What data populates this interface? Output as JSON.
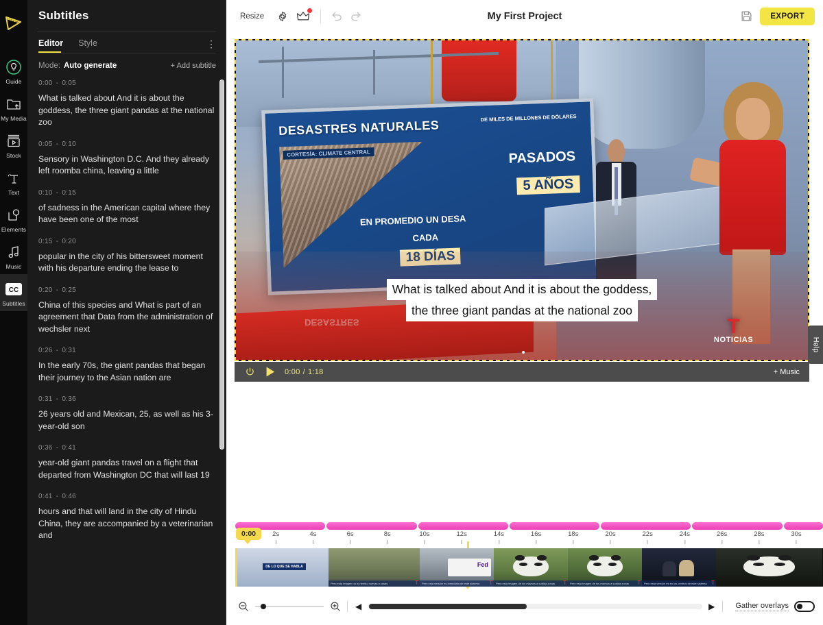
{
  "rail": {
    "logo_icon": "play-film-logo-icon",
    "items": [
      {
        "label": "Guide",
        "icon": "lightbulb-icon",
        "active": false
      },
      {
        "label": "My Media",
        "icon": "folder-upload-icon",
        "active": false
      },
      {
        "label": "Stock",
        "icon": "stock-video-icon",
        "active": false
      },
      {
        "label": "Text",
        "icon": "text-icon",
        "active": false
      },
      {
        "label": "Elements",
        "icon": "elements-shapes-icon",
        "active": false
      },
      {
        "label": "Music",
        "icon": "music-note-icon",
        "active": false
      },
      {
        "label": "Subtitles",
        "icon": "cc-icon",
        "active": true
      }
    ]
  },
  "panel": {
    "title": "Subtitles",
    "tabs": [
      {
        "label": "Editor",
        "active": true
      },
      {
        "label": "Style",
        "active": false
      }
    ],
    "kebab_icon": "more-vertical-icon",
    "mode_label": "Mode:",
    "mode_value": "Auto generate",
    "add_subtitle_label": "+ Add subtitle",
    "subtitles": [
      {
        "start": "0:00",
        "end": "0:05",
        "text": "What is talked about And it is about the goddess, the three giant pandas at the national zoo"
      },
      {
        "start": "0:05",
        "end": "0:10",
        "text": "Sensory in Washington D.C. And they already left roomba china, leaving a little"
      },
      {
        "start": "0:10",
        "end": "0:15",
        "text": "of sadness in the American capital where they have been one of the most"
      },
      {
        "start": "0:15",
        "end": "0:20",
        "text": "popular in the city of his bittersweet moment with his departure ending the lease to"
      },
      {
        "start": "0:20",
        "end": "0:25",
        "text": "China of this species and What is part of an agreement that Data from the administration of wechsler next"
      },
      {
        "start": "0:26",
        "end": "0:31",
        "text": "In the early 70s, the giant pandas that began their journey to the Asian nation are"
      },
      {
        "start": "0:31",
        "end": "0:36",
        "text": "26 years old and Mexican, 25, as well as his 3-year-old son"
      },
      {
        "start": "0:36",
        "end": "0:41",
        "text": "year-old giant pandas travel on a flight that departed from Washington DC that will last 19"
      },
      {
        "start": "0:41",
        "end": "0:46",
        "text": "hours and that will land in the city of Hindu China, they are accompanied by a veterinarian and"
      }
    ]
  },
  "toolbar": {
    "resize_label": "Resize",
    "settings_icon": "gear-icon",
    "upgrade_icon": "crown-icon",
    "undo_icon": "undo-icon",
    "redo_icon": "redo-icon",
    "project_title": "My First Project",
    "save_icon": "save-disk-icon",
    "export_label": "EXPORT"
  },
  "preview": {
    "caption_line1": "What is talked about And it is about the goddess,",
    "caption_line2": "the three giant pandas at the national zoo",
    "scene": {
      "board_title": "DESASTRES NATURALES",
      "board_subtitle": "DE MILES DE MILLONES DE DÓLARES",
      "board_courtesy": "CORTESÍA: CLIMATE CENTRAL",
      "board_pasados": "PASADOS",
      "board_years": "5 AÑOS",
      "board_promedio": "EN PROMEDIO UN DESA",
      "board_cada": "CADA",
      "board_dias": "18 DÍAS",
      "reflection_1": "DESASTRES",
      "reflection_2": "EN PROMEDIO UN DESA",
      "channel_logo": "T",
      "channel_name": "NOTICIAS"
    }
  },
  "player": {
    "loop_icon": "loop-icon",
    "play_icon": "play-icon",
    "current_time": "0:00",
    "separator": "/",
    "total_time": "1:18",
    "add_music_label": "+ Music"
  },
  "help": {
    "label": "Help"
  },
  "timeline": {
    "playhead_label": "0:00",
    "ticks": [
      "2s",
      "4s",
      "6s",
      "8s",
      "10s",
      "12s",
      "14s",
      "16s",
      "18s",
      "20s",
      "22s",
      "24s",
      "26s",
      "28s",
      "30s"
    ],
    "overlay_segments": [
      {
        "start": "0:00",
        "end": "0:05"
      },
      {
        "start": "0:05",
        "end": "0:10"
      },
      {
        "start": "0:10",
        "end": "0:15"
      },
      {
        "start": "0:15",
        "end": "0:20"
      },
      {
        "start": "0:20",
        "end": "0:25"
      },
      {
        "start": "0:26",
        "end": "0:31"
      },
      {
        "start": "0:31",
        "end": "0:36"
      }
    ],
    "clips": [
      {
        "caption": "DE LO QUE SE HABLA",
        "kind": "studio"
      },
      {
        "caption": "Pero esta imagen no ha tenido nuevas a casas",
        "kind": "zoo-crowd"
      },
      {
        "caption": "Pero esta versión es inmediata de este sistema",
        "kind": "street-truck"
      },
      {
        "caption": "Pero esta imagen de los mismos a subida zonas",
        "kind": "panda-grass"
      },
      {
        "caption": "Pero esta imagen de los mismos a subida zonas",
        "kind": "panda-bamboo"
      },
      {
        "caption": "Pero esta versión es en los centros de este sistema",
        "kind": "interview"
      },
      {
        "caption": "",
        "kind": "panda-night"
      }
    ],
    "zoom_out_icon": "zoom-out-icon",
    "zoom_in_icon": "zoom-in-icon",
    "scroll_left_icon": "chevron-left-icon",
    "scroll_right_icon": "chevron-right-icon",
    "gather_overlays_label": "Gather overlays",
    "gather_overlays_on": false
  },
  "colors": {
    "accent_yellow": "#f2e544",
    "panel_bg": "#1b1b1b",
    "rail_bg": "#0b0b0b",
    "overlay_pink": "#ec3fb4",
    "playhead": "#f4d94e"
  }
}
